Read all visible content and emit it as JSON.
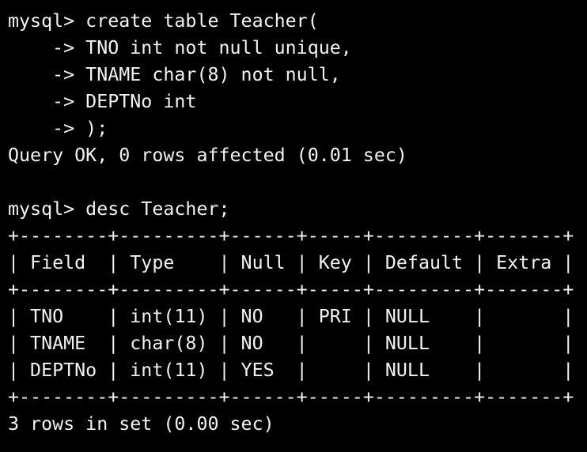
{
  "terminal": {
    "lines": [
      "mysql> create table Teacher(",
      "    -> TNO int not null unique,",
      "    -> TNAME char(8) not null,",
      "    -> DEPTNo int",
      "    -> );",
      "Query OK, 0 rows affected (0.01 sec)",
      "",
      "mysql> desc Teacher;",
      "+--------+---------+------+-----+---------+-------+",
      "| Field  | Type    | Null | Key | Default | Extra |",
      "+--------+---------+------+-----+---------+-------+",
      "| TNO    | int(11) | NO   | PRI | NULL    |       |",
      "| TNAME  | char(8) | NO   |     | NULL    |       |",
      "| DEPTNo | int(11) | YES  |     | NULL    |       |",
      "+--------+---------+------+-----+---------+-------+",
      "3 rows in set (0.00 sec)"
    ]
  }
}
